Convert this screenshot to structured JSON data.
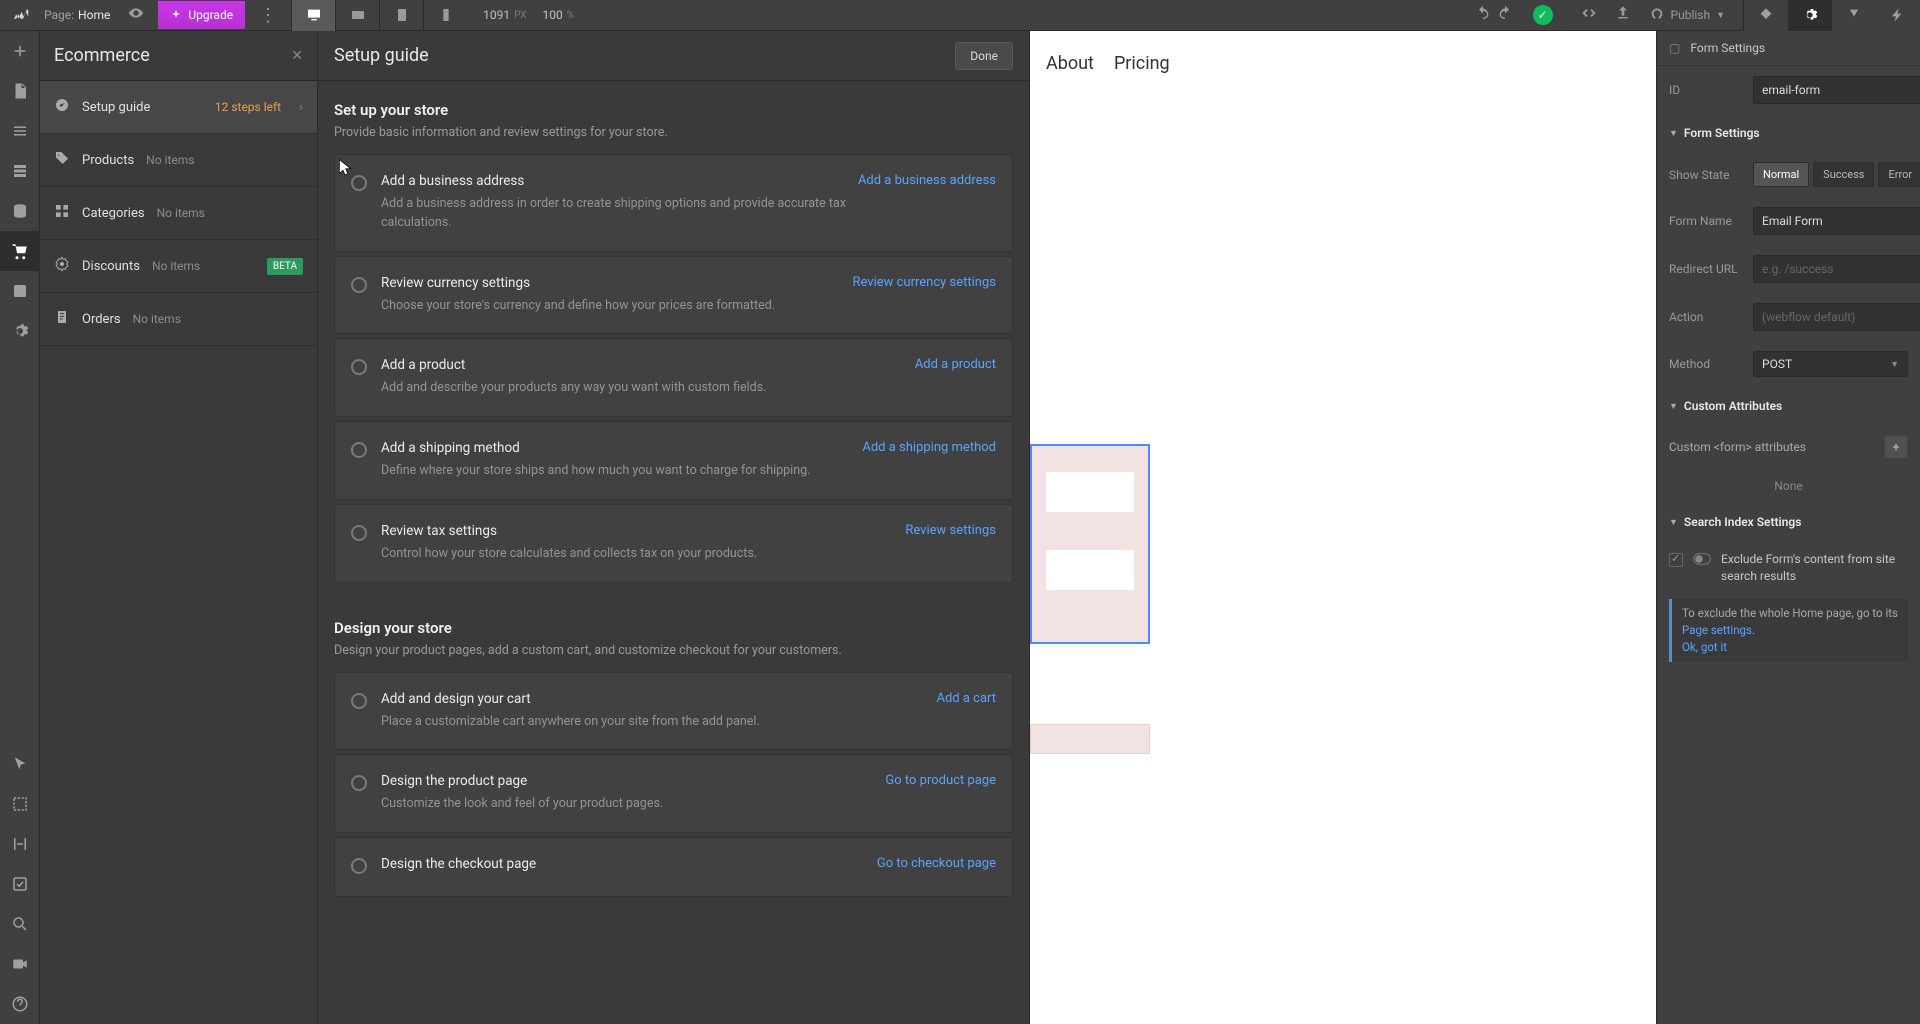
{
  "topbar": {
    "page_label": "Page:",
    "page_name": "Home",
    "upgrade": "Upgrade",
    "width": "1091",
    "px": "PX",
    "zoom": "100",
    "pct": "%",
    "publish": "Publish"
  },
  "ecom": {
    "title": "Ecommerce",
    "items": [
      {
        "label": "Setup guide",
        "meta": "12 steps left",
        "type": "guide"
      },
      {
        "label": "Products",
        "meta": "No items",
        "type": "products"
      },
      {
        "label": "Categories",
        "meta": "No items",
        "type": "categories"
      },
      {
        "label": "Discounts",
        "meta": "No items",
        "type": "discounts",
        "beta": "BETA"
      },
      {
        "label": "Orders",
        "meta": "No items",
        "type": "orders"
      }
    ]
  },
  "setup": {
    "title": "Setup guide",
    "done": "Done",
    "sections": [
      {
        "heading": "Set up your store",
        "sub": "Provide basic information and review settings for your store.",
        "tasks": [
          {
            "title": "Add a business address",
            "action": "Add a business address",
            "desc": "Add a business address in order to create shipping options and provide accurate tax calculations."
          },
          {
            "title": "Review currency settings",
            "action": "Review currency settings",
            "desc": "Choose your store's currency and define how your prices are formatted."
          },
          {
            "title": "Add a product",
            "action": "Add a product",
            "desc": "Add and describe your products any way you want with custom fields."
          },
          {
            "title": "Add a shipping method",
            "action": "Add a shipping method",
            "desc": "Define where your store ships and how much you want to charge for shipping."
          },
          {
            "title": "Review tax settings",
            "action": "Review settings",
            "desc": "Control how your store calculates and collects tax on your products."
          }
        ]
      },
      {
        "heading": "Design your store",
        "sub": "Design your product pages, add a custom cart, and customize checkout for your customers.",
        "tasks": [
          {
            "title": "Add and design your cart",
            "action": "Add a cart",
            "desc": "Place a customizable cart anywhere on your site from the add panel."
          },
          {
            "title": "Design the product page",
            "action": "Go to product page",
            "desc": "Customize the look and feel of your product pages."
          },
          {
            "title": "Design the checkout page",
            "action": "Go to checkout page",
            "desc": ""
          }
        ]
      }
    ]
  },
  "canvas": {
    "nav": [
      "About",
      "Pricing"
    ]
  },
  "right": {
    "breadcrumb": "Form Settings",
    "id_label": "ID",
    "id_value": "email-form",
    "form_settings_hdr": "Form Settings",
    "show_state_label": "Show State",
    "states": [
      "Normal",
      "Success",
      "Error"
    ],
    "form_name_label": "Form Name",
    "form_name_value": "Email Form",
    "redirect_label": "Redirect URL",
    "redirect_placeholder": "e.g. /success",
    "action_label": "Action",
    "action_placeholder": "(webflow default)",
    "method_label": "Method",
    "method_value": "POST",
    "custom_attr_hdr": "Custom Attributes",
    "custom_attr_label": "Custom <form> attributes",
    "none": "None",
    "search_hdr": "Search Index Settings",
    "exclude_label": "Exclude Form's content from site search results",
    "tip_prefix": "To exclude the whole Home page, go to its ",
    "tip_link": "Page settings",
    "tip_suffix": ".",
    "tip_ok": "Ok, got it"
  }
}
